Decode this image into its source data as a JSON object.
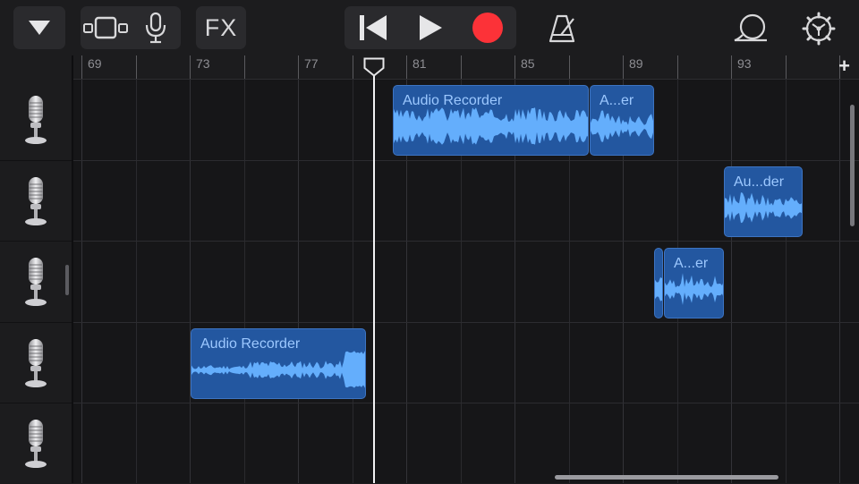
{
  "toolbar": {
    "fx_label": "FX"
  },
  "icons": {
    "menu": "triangle-down-icon",
    "view": "tracks-view-icon",
    "instrument": "microphone-icon",
    "rewind": "go-to-beginning-icon",
    "play": "play-icon",
    "record": "record-icon",
    "metronome": "metronome-icon",
    "loop": "loop-browser-icon",
    "settings": "settings-gear-icon"
  },
  "colors": {
    "record": "#fc3238",
    "region": "#2357a0",
    "region_text": "#9cc8ff",
    "waveform": "#64aefc"
  },
  "ruler": {
    "labels": [
      "69",
      "73",
      "77",
      "81",
      "85",
      "89",
      "93"
    ],
    "add_button": "+"
  },
  "tracks": [
    {
      "instrument": "microphone-icon",
      "regions": [
        {
          "label": "Audio Recorder"
        },
        {
          "label": "A...er"
        }
      ]
    },
    {
      "instrument": "microphone-icon",
      "regions": [
        {
          "label": "Au...der"
        }
      ]
    },
    {
      "instrument": "microphone-icon",
      "regions": [
        {
          "label": "A...er"
        }
      ]
    },
    {
      "instrument": "microphone-icon",
      "regions": [
        {
          "label": "Audio Recorder"
        }
      ]
    },
    {
      "instrument": "microphone-icon",
      "regions": []
    }
  ]
}
